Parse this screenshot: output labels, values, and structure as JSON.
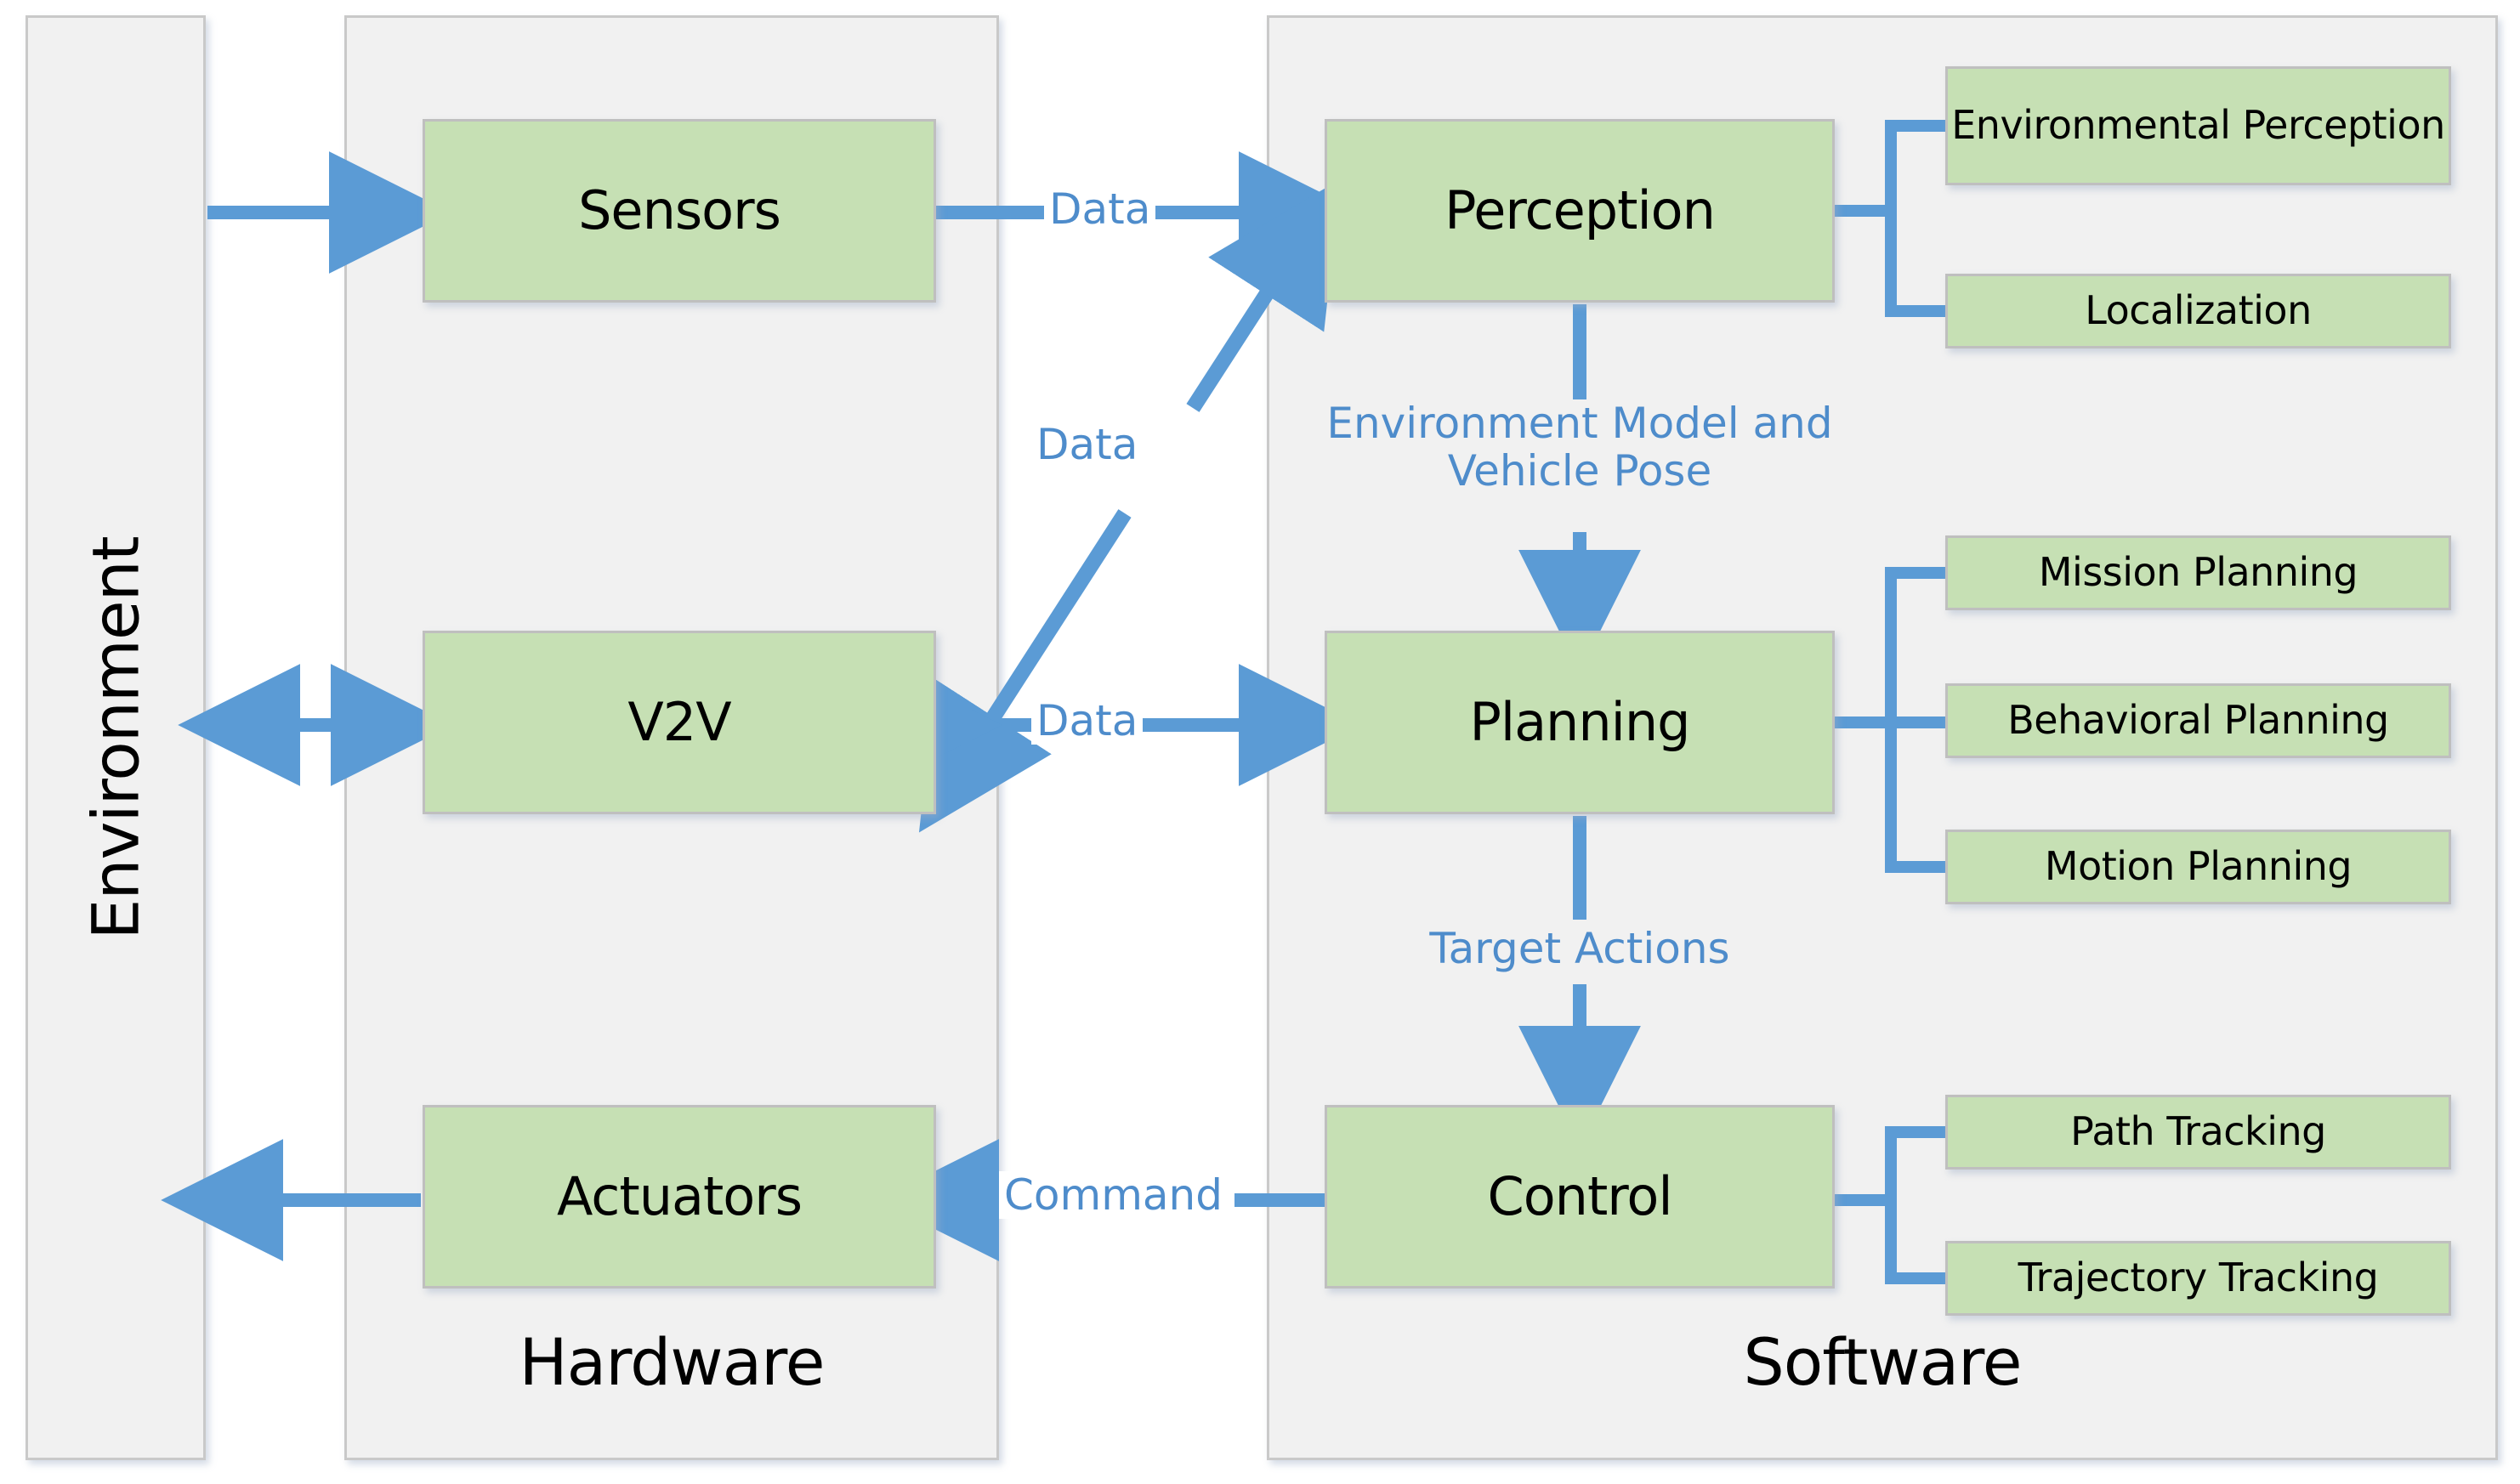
{
  "diagram": {
    "title": "Autonomous Driving System Architecture",
    "colors": {
      "panel_fill": "#F1F1F1",
      "panel_border": "#C9C9C9",
      "box_fill": "#C6E0B4",
      "box_border": "#BFBFBF",
      "arrow": "#5B9BD5",
      "edge_label_text": "#4E8CCB",
      "box_text": "#000000"
    }
  },
  "panels": {
    "environment": {
      "label": "Environment",
      "orientation": "vertical"
    },
    "hardware": {
      "label": "Hardware"
    },
    "software": {
      "label": "Software"
    }
  },
  "hardware_blocks": [
    {
      "id": "sensors",
      "label": "Sensors"
    },
    {
      "id": "v2v",
      "label": "V2V"
    },
    {
      "id": "actuators",
      "label": "Actuators"
    }
  ],
  "software_blocks": [
    {
      "id": "perception",
      "label": "Perception"
    },
    {
      "id": "planning",
      "label": "Planning"
    },
    {
      "id": "control",
      "label": "Control"
    }
  ],
  "perception_subitems": [
    {
      "id": "environmental-perception",
      "label": "Environmental Perception"
    },
    {
      "id": "localization",
      "label": "Localization"
    }
  ],
  "planning_subitems": [
    {
      "id": "mission-planning",
      "label": "Mission Planning"
    },
    {
      "id": "behavioral-planning",
      "label": "Behavioral Planning"
    },
    {
      "id": "motion-planning",
      "label": "Motion Planning"
    }
  ],
  "control_subitems": [
    {
      "id": "path-tracking",
      "label": "Path Tracking"
    },
    {
      "id": "trajectory-tracking",
      "label": "Trajectory Tracking"
    }
  ],
  "edge_labels": {
    "data_sensors_to_perception": "Data",
    "data_v2v_to_perception": "Data",
    "data_v2v_to_planning": "Data",
    "command_control_to_actuators": "Command",
    "environment_model_and_vehicle_pose": "Environment Model and Vehicle Pose",
    "target_actions": "Target Actions"
  },
  "connections": [
    {
      "from": "environment",
      "to": "sensors",
      "arrow": "single",
      "label": ""
    },
    {
      "from": "environment",
      "to": "v2v",
      "arrow": "double",
      "label": ""
    },
    {
      "from": "actuators",
      "to": "environment",
      "arrow": "single",
      "label": ""
    },
    {
      "from": "sensors",
      "to": "perception",
      "arrow": "single",
      "label": "Data"
    },
    {
      "from": "v2v",
      "to": "perception",
      "arrow": "double",
      "label": "Data"
    },
    {
      "from": "v2v",
      "to": "planning",
      "arrow": "double",
      "label": "Data"
    },
    {
      "from": "perception",
      "to": "planning",
      "arrow": "single",
      "label": "Environment Model and Vehicle Pose"
    },
    {
      "from": "planning",
      "to": "control",
      "arrow": "single",
      "label": "Target Actions"
    },
    {
      "from": "control",
      "to": "actuators",
      "arrow": "single",
      "label": "Command"
    }
  ]
}
